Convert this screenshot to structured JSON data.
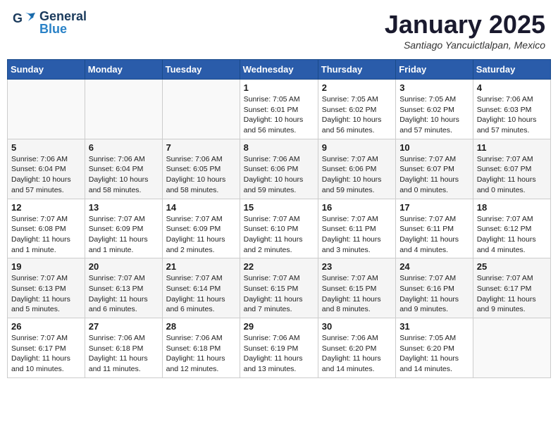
{
  "header": {
    "logo": {
      "general": "General",
      "blue": "Blue"
    },
    "title": "January 2025",
    "location": "Santiago Yancuictlalpan, Mexico"
  },
  "weekdays": [
    "Sunday",
    "Monday",
    "Tuesday",
    "Wednesday",
    "Thursday",
    "Friday",
    "Saturday"
  ],
  "weeks": [
    [
      {
        "day": "",
        "info": ""
      },
      {
        "day": "",
        "info": ""
      },
      {
        "day": "",
        "info": ""
      },
      {
        "day": "1",
        "info": "Sunrise: 7:05 AM\nSunset: 6:01 PM\nDaylight: 10 hours\nand 56 minutes."
      },
      {
        "day": "2",
        "info": "Sunrise: 7:05 AM\nSunset: 6:02 PM\nDaylight: 10 hours\nand 56 minutes."
      },
      {
        "day": "3",
        "info": "Sunrise: 7:05 AM\nSunset: 6:02 PM\nDaylight: 10 hours\nand 57 minutes."
      },
      {
        "day": "4",
        "info": "Sunrise: 7:06 AM\nSunset: 6:03 PM\nDaylight: 10 hours\nand 57 minutes."
      }
    ],
    [
      {
        "day": "5",
        "info": "Sunrise: 7:06 AM\nSunset: 6:04 PM\nDaylight: 10 hours\nand 57 minutes."
      },
      {
        "day": "6",
        "info": "Sunrise: 7:06 AM\nSunset: 6:04 PM\nDaylight: 10 hours\nand 58 minutes."
      },
      {
        "day": "7",
        "info": "Sunrise: 7:06 AM\nSunset: 6:05 PM\nDaylight: 10 hours\nand 58 minutes."
      },
      {
        "day": "8",
        "info": "Sunrise: 7:06 AM\nSunset: 6:06 PM\nDaylight: 10 hours\nand 59 minutes."
      },
      {
        "day": "9",
        "info": "Sunrise: 7:07 AM\nSunset: 6:06 PM\nDaylight: 10 hours\nand 59 minutes."
      },
      {
        "day": "10",
        "info": "Sunrise: 7:07 AM\nSunset: 6:07 PM\nDaylight: 11 hours\nand 0 minutes."
      },
      {
        "day": "11",
        "info": "Sunrise: 7:07 AM\nSunset: 6:07 PM\nDaylight: 11 hours\nand 0 minutes."
      }
    ],
    [
      {
        "day": "12",
        "info": "Sunrise: 7:07 AM\nSunset: 6:08 PM\nDaylight: 11 hours\nand 1 minute."
      },
      {
        "day": "13",
        "info": "Sunrise: 7:07 AM\nSunset: 6:09 PM\nDaylight: 11 hours\nand 1 minute."
      },
      {
        "day": "14",
        "info": "Sunrise: 7:07 AM\nSunset: 6:09 PM\nDaylight: 11 hours\nand 2 minutes."
      },
      {
        "day": "15",
        "info": "Sunrise: 7:07 AM\nSunset: 6:10 PM\nDaylight: 11 hours\nand 2 minutes."
      },
      {
        "day": "16",
        "info": "Sunrise: 7:07 AM\nSunset: 6:11 PM\nDaylight: 11 hours\nand 3 minutes."
      },
      {
        "day": "17",
        "info": "Sunrise: 7:07 AM\nSunset: 6:11 PM\nDaylight: 11 hours\nand 4 minutes."
      },
      {
        "day": "18",
        "info": "Sunrise: 7:07 AM\nSunset: 6:12 PM\nDaylight: 11 hours\nand 4 minutes."
      }
    ],
    [
      {
        "day": "19",
        "info": "Sunrise: 7:07 AM\nSunset: 6:13 PM\nDaylight: 11 hours\nand 5 minutes."
      },
      {
        "day": "20",
        "info": "Sunrise: 7:07 AM\nSunset: 6:13 PM\nDaylight: 11 hours\nand 6 minutes."
      },
      {
        "day": "21",
        "info": "Sunrise: 7:07 AM\nSunset: 6:14 PM\nDaylight: 11 hours\nand 6 minutes."
      },
      {
        "day": "22",
        "info": "Sunrise: 7:07 AM\nSunset: 6:15 PM\nDaylight: 11 hours\nand 7 minutes."
      },
      {
        "day": "23",
        "info": "Sunrise: 7:07 AM\nSunset: 6:15 PM\nDaylight: 11 hours\nand 8 minutes."
      },
      {
        "day": "24",
        "info": "Sunrise: 7:07 AM\nSunset: 6:16 PM\nDaylight: 11 hours\nand 9 minutes."
      },
      {
        "day": "25",
        "info": "Sunrise: 7:07 AM\nSunset: 6:17 PM\nDaylight: 11 hours\nand 9 minutes."
      }
    ],
    [
      {
        "day": "26",
        "info": "Sunrise: 7:07 AM\nSunset: 6:17 PM\nDaylight: 11 hours\nand 10 minutes."
      },
      {
        "day": "27",
        "info": "Sunrise: 7:06 AM\nSunset: 6:18 PM\nDaylight: 11 hours\nand 11 minutes."
      },
      {
        "day": "28",
        "info": "Sunrise: 7:06 AM\nSunset: 6:18 PM\nDaylight: 11 hours\nand 12 minutes."
      },
      {
        "day": "29",
        "info": "Sunrise: 7:06 AM\nSunset: 6:19 PM\nDaylight: 11 hours\nand 13 minutes."
      },
      {
        "day": "30",
        "info": "Sunrise: 7:06 AM\nSunset: 6:20 PM\nDaylight: 11 hours\nand 14 minutes."
      },
      {
        "day": "31",
        "info": "Sunrise: 7:05 AM\nSunset: 6:20 PM\nDaylight: 11 hours\nand 14 minutes."
      },
      {
        "day": "",
        "info": ""
      }
    ]
  ]
}
